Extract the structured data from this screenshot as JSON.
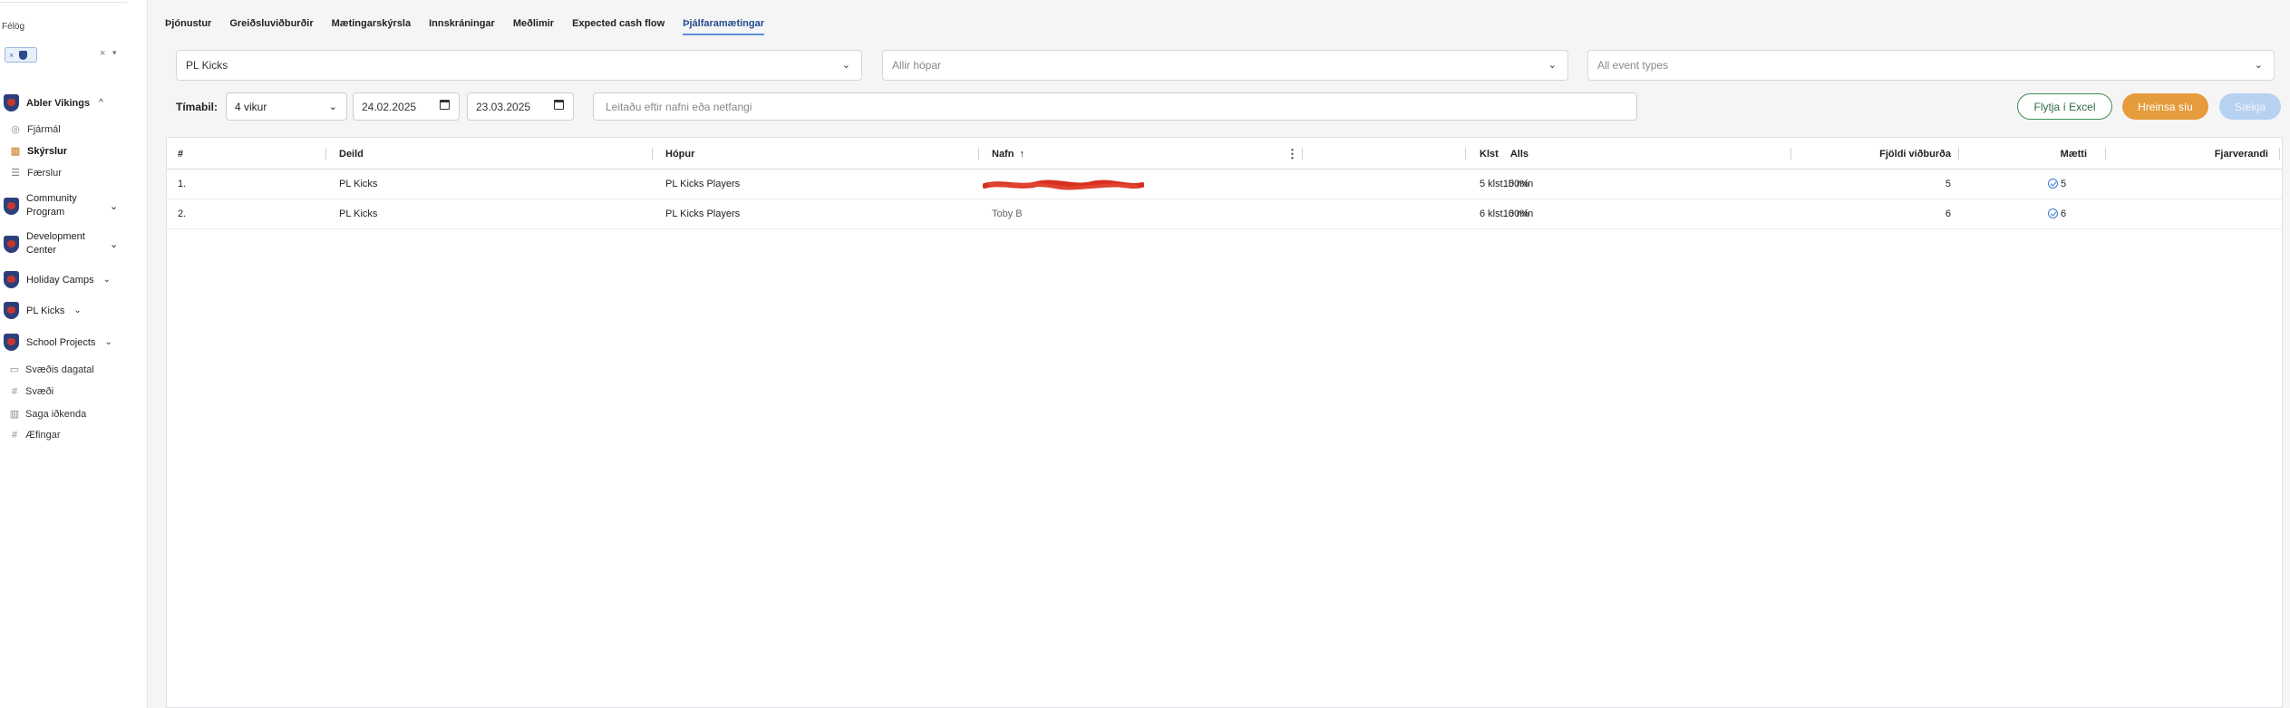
{
  "sidebar": {
    "club_label": "Félög",
    "club_chip_remove": "×",
    "clear": "×",
    "caret": "▾",
    "club": {
      "name": "Abler Vikings",
      "chevron": "^"
    },
    "club_items": [
      {
        "label": "Fjármál",
        "icon": "money-icon",
        "glyph": "◎"
      },
      {
        "label": "Skýrslur",
        "icon": "chart-icon",
        "glyph": "▥",
        "active": true
      },
      {
        "label": "Færslur",
        "icon": "list-icon",
        "glyph": "☰"
      }
    ],
    "groups": [
      {
        "label": "Community Program",
        "chevron": "⌄"
      },
      {
        "label": "Development Center",
        "chevron": "⌄"
      },
      {
        "label": "Holiday Camps",
        "chevron": "⌄"
      },
      {
        "label": "PL Kicks",
        "chevron": "⌄"
      },
      {
        "label": "School Projects",
        "chevron": "⌄"
      }
    ],
    "utilities": [
      {
        "label": "Svæðis dagatal",
        "icon": "calendar-icon",
        "glyph": "▭"
      },
      {
        "label": "Svæði",
        "icon": "hash-icon",
        "glyph": "#"
      },
      {
        "label": "Saga iðkenda",
        "icon": "bar-chart-icon",
        "glyph": "▥"
      },
      {
        "label": "Æfingar",
        "icon": "hash-icon",
        "glyph": "#"
      }
    ]
  },
  "tabs": [
    {
      "label": "Þjónustur"
    },
    {
      "label": "Greiðsluviðburðir"
    },
    {
      "label": "Mætingarskýrsla"
    },
    {
      "label": "Innskráningar"
    },
    {
      "label": "Meðlimir"
    },
    {
      "label": "Expected cash flow"
    },
    {
      "label": "Þjálfaramætingar",
      "active": true
    }
  ],
  "filters": {
    "department": "PL Kicks",
    "groups_placeholder": "Allir hópar",
    "event_types_placeholder": "All event types",
    "dropdown_glyph": "⌄"
  },
  "period": {
    "label": "Tímabil:",
    "range": "4 vikur",
    "from": "24.02.2025",
    "to": "23.03.2025"
  },
  "search": {
    "placeholder": "Leitaðu eftir nafni eða netfangi"
  },
  "buttons": {
    "excel": "Flytja í Excel",
    "clear": "Hreinsa síu",
    "fetch": "Sækja"
  },
  "table": {
    "headers": {
      "num": "#",
      "department": "Deild",
      "group": "Hópur",
      "name": "Nafn",
      "sort": "↑",
      "menu": "⋮",
      "total": "Alls",
      "hours": "Klst",
      "events": "Fjöldi viðburða",
      "attended": "Mætti",
      "absent": "Fjarverandi"
    },
    "rows": [
      {
        "num": "1.",
        "department": "PL Kicks",
        "group": "PL Kicks Players",
        "name": "",
        "total": "100%",
        "hours": "5 klst. 5 mín",
        "events": "5",
        "attended": "5"
      },
      {
        "num": "2.",
        "department": "PL Kicks",
        "group": "PL Kicks Players",
        "name": "Toby B",
        "total": "100%",
        "hours": "6 klst. 6 mín",
        "events": "6",
        "attended": "6"
      }
    ]
  },
  "colors": {
    "accent": "#244a8a",
    "excel_border": "#3e8f56",
    "clear_button": "#e59c3c",
    "fetch_button": "#b7d1f1",
    "redaction": "#d8301f"
  }
}
